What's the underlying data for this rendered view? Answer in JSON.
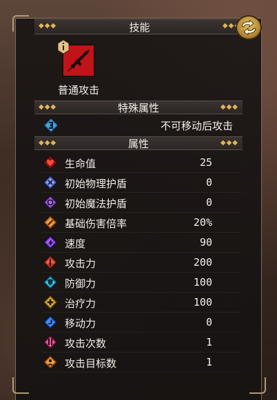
{
  "header": {
    "title": "技能"
  },
  "skill": {
    "name": "普通攻击",
    "badge_icon": "info-icon",
    "icon": "sword-icon",
    "icon_color": "#c0141a"
  },
  "special": {
    "title": "特殊属性",
    "text": "不可移动后攻击",
    "icon": "no-move-icon"
  },
  "attributes": {
    "title": "属性",
    "items": [
      {
        "label": "生命值",
        "value": "25",
        "icon": "heart-icon",
        "color": "#d42a2a"
      },
      {
        "label": "初始物理护盾",
        "value": "0",
        "icon": "physical-shield-icon",
        "color": "#6a7fd8"
      },
      {
        "label": "初始魔法护盾",
        "value": "0",
        "icon": "magic-shield-icon",
        "color": "#9a5ad8"
      },
      {
        "label": "基础伤害倍率",
        "value": "20%",
        "icon": "damage-multiplier-icon",
        "color": "#e07a2a"
      },
      {
        "label": "速度",
        "value": "90",
        "icon": "speed-icon",
        "color": "#8a44d6"
      },
      {
        "label": "攻击力",
        "value": "200",
        "icon": "attack-icon",
        "color": "#d6402a"
      },
      {
        "label": "防御力",
        "value": "100",
        "icon": "defense-icon",
        "color": "#36b6d6"
      },
      {
        "label": "治疗力",
        "value": "100",
        "icon": "heal-icon",
        "color": "#e8b82a"
      },
      {
        "label": "移动力",
        "value": "0",
        "icon": "move-icon",
        "color": "#2a68d6"
      },
      {
        "label": "攻击次数",
        "value": "1",
        "icon": "attack-count-icon",
        "color": "#c8366e"
      },
      {
        "label": "攻击目标数",
        "value": "1",
        "icon": "target-count-icon",
        "color": "#e08a2a"
      }
    ]
  }
}
